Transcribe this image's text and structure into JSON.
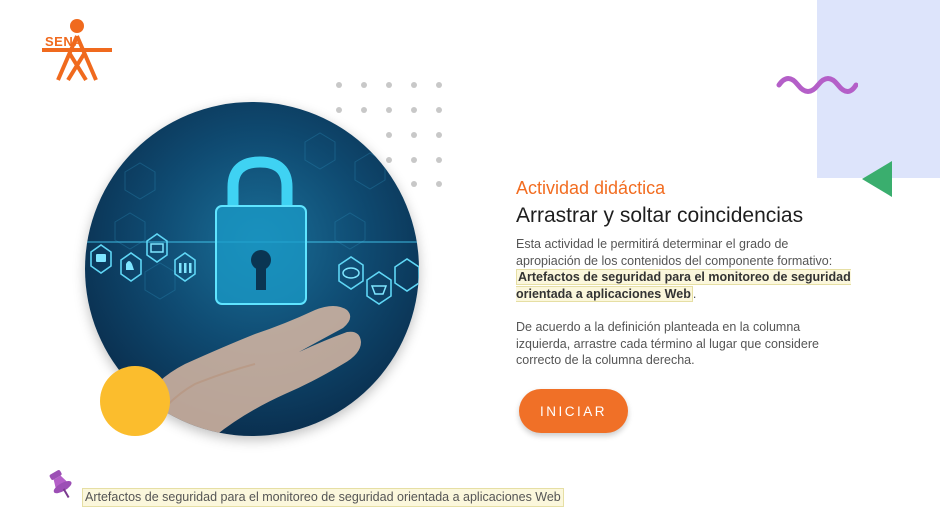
{
  "logo": {
    "text": "SENA"
  },
  "header": {
    "subtitle": "Actividad didáctica",
    "title": "Arrastrar y soltar coincidencias"
  },
  "intro": {
    "text": "Esta actividad le permitirá determinar el grado de apropiación de los contenidos del componente formativo: ",
    "highlight": "Artefactos de seguridad para el monitoreo de seguridad orientada a aplicaciones Web",
    "end": "."
  },
  "instructions": {
    "text": "De acuerdo a la definición planteada en la columna izquierda, arrastre cada término al lugar que considere correcto de la columna derecha."
  },
  "start_button": {
    "label": "INICIAR"
  },
  "footer": {
    "link_text": "Artefactos de seguridad para el monitoreo de seguridad orientada a aplicaciones Web"
  },
  "colors": {
    "accent_orange": "#f07027",
    "yellow": "#fbbd2d",
    "green": "#3aae6e",
    "purple": "#b45fc8",
    "panel_blue": "#dde4fb"
  },
  "icons": [
    "sena-logo-icon",
    "lock-icon",
    "hand-icon",
    "pushpin-icon",
    "squiggle-decoration"
  ]
}
